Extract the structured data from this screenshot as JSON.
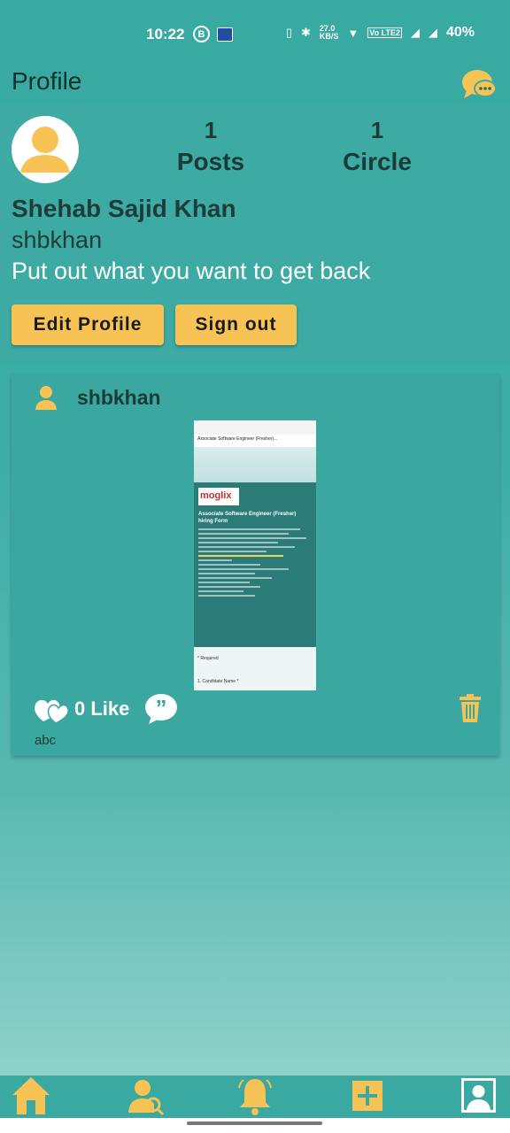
{
  "status_bar": {
    "time": "10:22",
    "b_icon": "B",
    "speed": "27.0\nKB/S",
    "network": "Vo LTE2",
    "battery": "40%"
  },
  "header": {
    "title": "Profile",
    "chat_icon": "chat-bubble-icon"
  },
  "profile": {
    "posts_count": "1",
    "posts_label": "Posts",
    "circle_count": "1",
    "circle_label": "Circle",
    "display_name": "Shehab Sajid Khan",
    "username": "shbkhan",
    "bio": "Put out what you want to get back",
    "edit_button": "Edit Profile",
    "signout_button": "Sign out"
  },
  "post": {
    "username": "shbkhan",
    "image": {
      "url_title": "Associate Software Engineer (Fresher)...",
      "logo": "moglix",
      "form_title": "Associate Software Engineer (Fresher) hiring Form",
      "required": "* Required",
      "field": "1. Candidate Name *"
    },
    "likes": "0 Like",
    "caption": "abc"
  },
  "nav": {
    "home": "home-icon",
    "search": "user-search-icon",
    "notifications": "bell-icon",
    "add": "add-icon",
    "profile": "profile-icon"
  },
  "colors": {
    "accent": "#f7c355",
    "background": "#3aaca4"
  }
}
